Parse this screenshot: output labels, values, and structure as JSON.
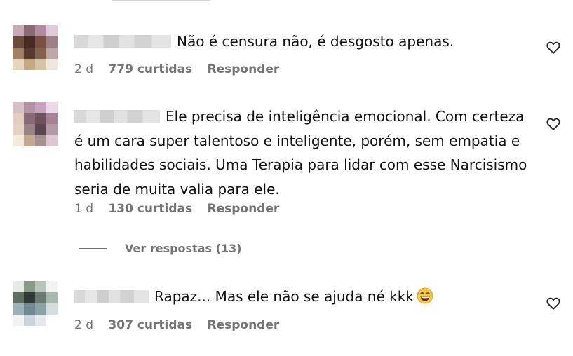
{
  "comments": [
    {
      "text": "Não é censura não, é desgosto apenas.",
      "time": "2 d",
      "likes": "779 curtidas",
      "reply": "Responder"
    },
    {
      "text": "Ele precisa de inteligência emocional. Com certeza é um cara super talentoso e inteligente, porém, sem empatia e habilidades sociais. Uma Terapia para lidar com esse Narcisismo seria de muita valia para ele.",
      "time": "1 d",
      "likes": "130 curtidas",
      "reply": "Responder",
      "view_replies": "Ver respostas (13)"
    },
    {
      "text": "Rapaz... Mas ele não se ajuda né kkk",
      "emoji": "grinning-sweat-emoji",
      "time": "2 d",
      "likes": "307 curtidas",
      "reply": "Responder"
    }
  ],
  "colors": {
    "meta": "#737373",
    "text": "#111111",
    "background": "#ffffff"
  },
  "icons": {
    "like": "heart-outline-icon"
  }
}
